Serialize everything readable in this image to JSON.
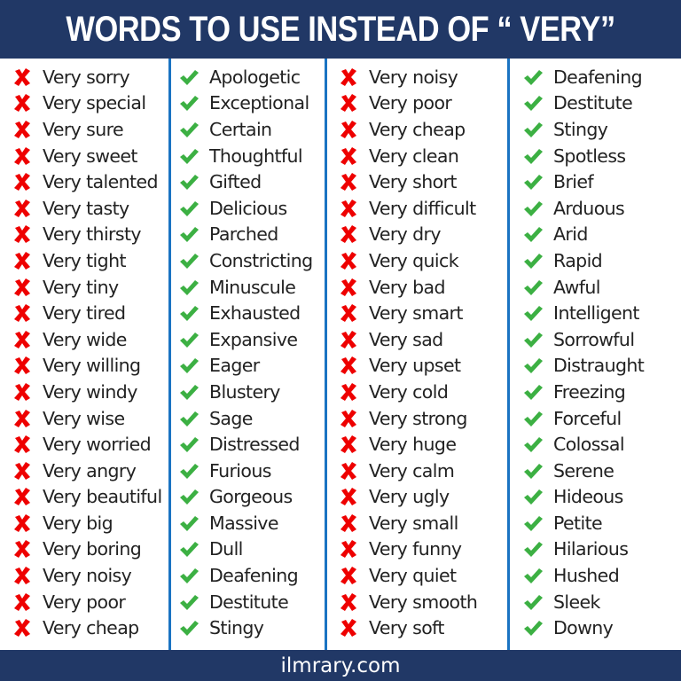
{
  "header": {
    "title": "WORDS TO USE INSTEAD OF “ VERY”"
  },
  "footer": {
    "site": "ilmrary.com"
  },
  "colors": {
    "banner": "#213866",
    "divider": "#1a73c2",
    "cross": "#ee0000",
    "check": "#3cb043",
    "text": "#222222"
  },
  "columns": [
    {
      "kind": "avoid",
      "icon": "cross-icon",
      "items": [
        "Very sorry",
        "Very special",
        "Very sure",
        "Very sweet",
        "Very talented",
        "Very tasty",
        "Very thirsty",
        "Very tight",
        "Very tiny",
        "Very tired",
        "Very wide",
        "Very willing",
        "Very windy",
        "Very wise",
        "Very worried",
        "Very angry",
        "Very beautiful",
        "Very big",
        "Very boring",
        "Very noisy",
        "Very poor",
        "Very cheap"
      ]
    },
    {
      "kind": "use",
      "icon": "check-icon",
      "items": [
        "Apologetic",
        "Exceptional",
        "Certain",
        "Thoughtful",
        "Gifted",
        "Delicious",
        "Parched",
        "Constricting",
        "Minuscule",
        "Exhausted",
        "Expansive",
        "Eager",
        "Blustery",
        "Sage",
        "Distressed",
        "Furious",
        "Gorgeous",
        "Massive",
        "Dull",
        "Deafening",
        "Destitute",
        "Stingy"
      ]
    },
    {
      "kind": "avoid",
      "icon": "cross-icon",
      "items": [
        "Very noisy",
        "Very poor",
        "Very cheap",
        "Very clean",
        "Very short",
        "Very difficult",
        "Very dry",
        "Very quick",
        "Very bad",
        "Very smart",
        "Very sad",
        "Very upset",
        "Very cold",
        "Very strong",
        "Very huge",
        "Very calm",
        "Very ugly",
        "Very small",
        "Very funny",
        "Very quiet",
        "Very smooth",
        "Very soft"
      ]
    },
    {
      "kind": "use",
      "icon": "check-icon",
      "items": [
        "Deafening",
        "Destitute",
        "Stingy",
        "Spotless",
        "Brief",
        "Arduous",
        "Arid",
        "Rapid",
        "Awful",
        "Intelligent",
        "Sorrowful",
        "Distraught",
        "Freezing",
        "Forceful",
        "Colossal",
        "Serene",
        "Hideous",
        "Petite",
        "Hilarious",
        "Hushed",
        "Sleek",
        "Downy"
      ]
    }
  ]
}
